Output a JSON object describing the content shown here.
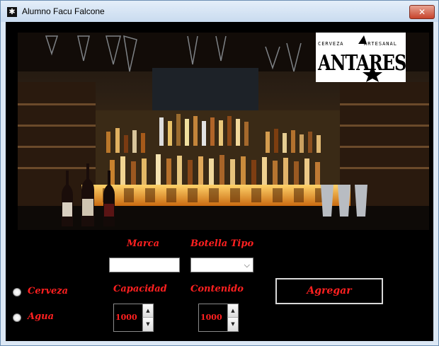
{
  "window": {
    "title": "Alumno Facu Falcone",
    "close_glyph": "✕",
    "app_icon": "gear-icon"
  },
  "logo": {
    "top_left": "CERVEZA",
    "top_right": "ARTESANAL",
    "brand": "ANTARES"
  },
  "image": {
    "subject": "bar-shelves-photo"
  },
  "form": {
    "marca_label": "Marca",
    "marca_value": "",
    "botella_tipo_label": "Botella Tipo",
    "botella_tipo_value": "",
    "cerveza_label": "Cerveza",
    "agua_label": "Agua",
    "capacidad_label": "Capacidad",
    "capacidad_value": "1000",
    "contenido_label": "Contenido",
    "contenido_value": "1000",
    "agregar_label": "Agregar"
  },
  "colors": {
    "label": "#ff2020",
    "background": "#000000"
  }
}
